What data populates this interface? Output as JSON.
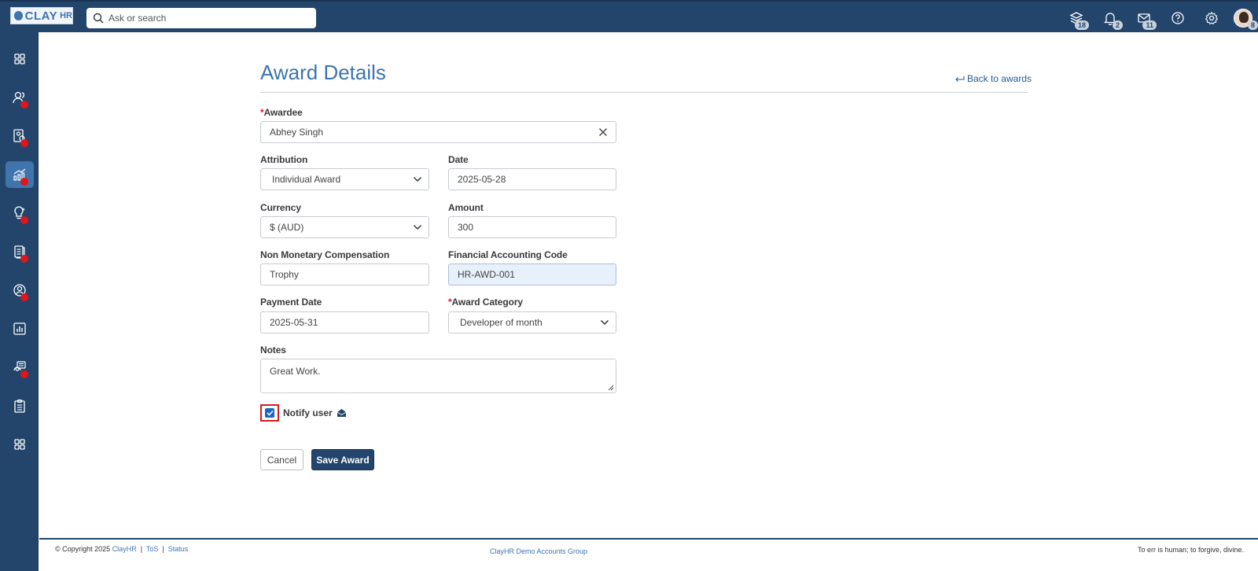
{
  "app": {
    "logo_text": "CLAY",
    "logo_suffix": "HR"
  },
  "search": {
    "placeholder": "Ask or search"
  },
  "topbar": {
    "layers_badge": "18",
    "notifications_badge": "2",
    "messages_badge": "11",
    "avatar_badge": "8"
  },
  "page": {
    "title": "Award Details",
    "back_link": "Back to awards"
  },
  "form": {
    "awardee": {
      "label": "Awardee",
      "value": "Abhey Singh"
    },
    "attribution": {
      "label": "Attribution",
      "value": "Individual Award"
    },
    "date": {
      "label": "Date",
      "value": "2025-05-28"
    },
    "currency": {
      "label": "Currency",
      "value": "$ (AUD)"
    },
    "amount": {
      "label": "Amount",
      "value": "300"
    },
    "non_monetary": {
      "label": "Non Monetary Compensation",
      "value": "Trophy"
    },
    "accounting_code": {
      "label": "Financial Accounting Code",
      "value": "HR-AWD-001"
    },
    "payment_date": {
      "label": "Payment Date",
      "value": "2025-05-31"
    },
    "award_category": {
      "label": "Award Category",
      "value": "Developer of month"
    },
    "notes": {
      "label": "Notes",
      "value": "Great Work."
    },
    "notify": {
      "label": "Notify user",
      "checked": true
    },
    "required_mark": "*"
  },
  "buttons": {
    "cancel": "Cancel",
    "save": "Save Award"
  },
  "footer": {
    "copyright": "© Copyright 2025",
    "brand_link": "ClayHR",
    "sep": "|",
    "tos": "ToS",
    "status": "Status",
    "center": "ClayHR Demo Accounts Group",
    "right": "To err is human; to forgive, divine."
  },
  "colors": {
    "nav_bg": "#23456b",
    "accent": "#3c74b1",
    "alert": "#e3141b"
  }
}
